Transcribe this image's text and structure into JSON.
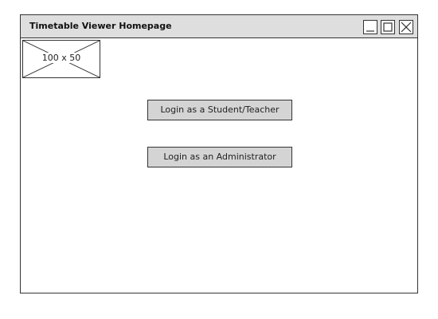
{
  "window": {
    "title": "Timetable Viewer Homepage",
    "controls": {
      "minimize_icon": "minimize-icon",
      "maximize_icon": "maximize-icon",
      "close_icon": "close-icon"
    }
  },
  "image_placeholder": {
    "label": "100 x 50"
  },
  "buttons": {
    "student_teacher_login": "Login as a Student/Teacher",
    "admin_login": "Login as an Administrator"
  },
  "colors": {
    "titlebar_bg": "#dedede",
    "button_bg": "#d4d4d4",
    "border": "#333333"
  }
}
